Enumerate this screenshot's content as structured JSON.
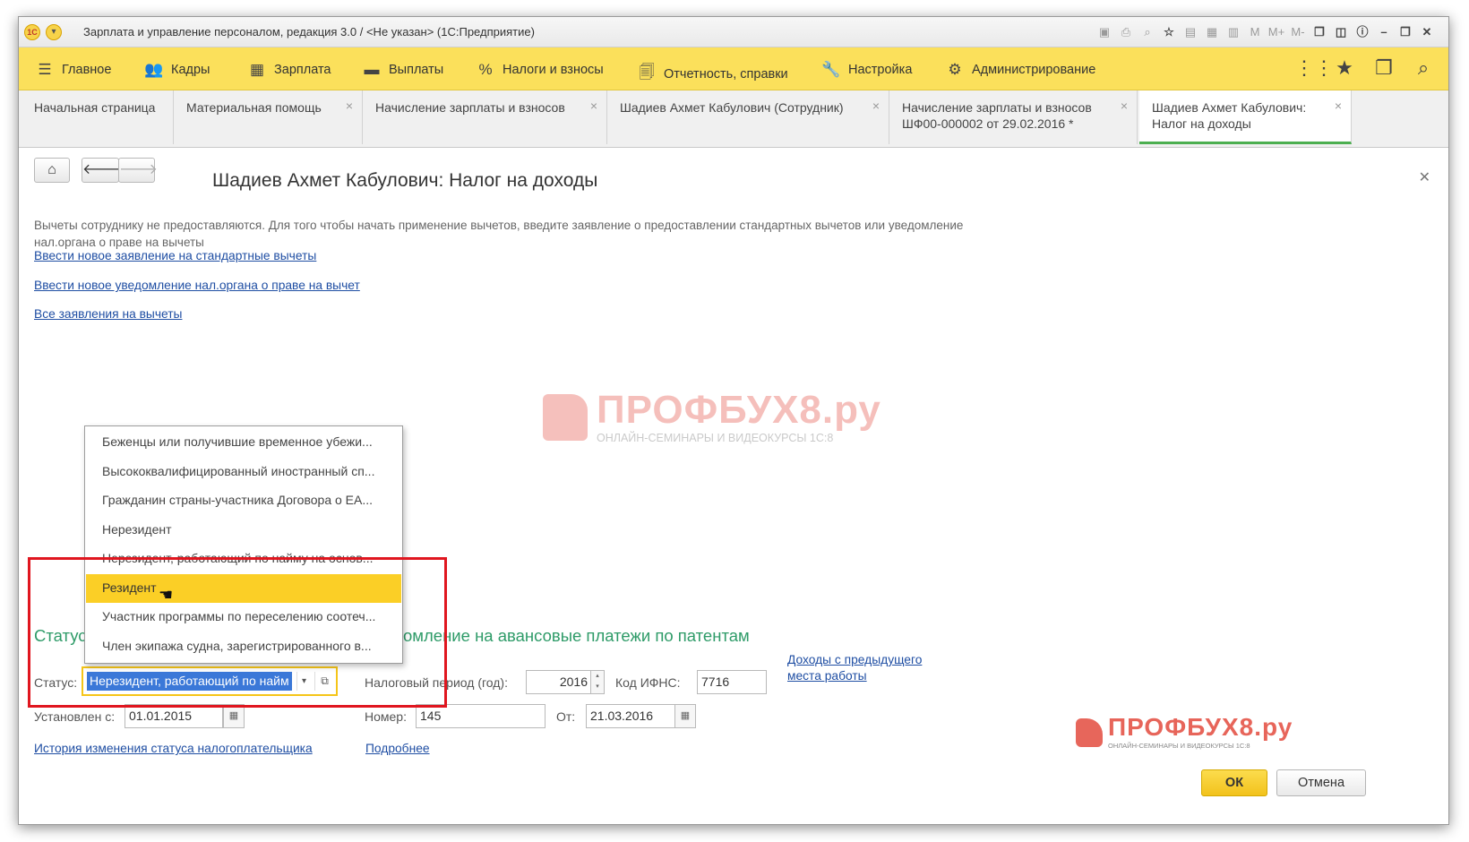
{
  "window": {
    "title": "Зарплата и управление персоналом, редакция 3.0 / <Не указан>  (1С:Предприятие)",
    "title_icons": [
      "save-icon",
      "print-icon",
      "preview-icon",
      "favorites-icon",
      "history-icon",
      "calculator-icon",
      "calendar-icon",
      "M",
      "M+",
      "M-",
      "windows-icon",
      "layout-icon",
      "info-icon",
      "minimize-icon",
      "restore-icon",
      "close-icon"
    ]
  },
  "sections": {
    "items": [
      {
        "label": "Главное",
        "icon": "☰"
      },
      {
        "label": "Кадры",
        "icon": "👥"
      },
      {
        "label": "Зарплата",
        "icon": "▦"
      },
      {
        "label": "Выплаты",
        "icon": "▬"
      },
      {
        "label": "Налоги и взносы",
        "icon": "%"
      },
      {
        "label": "Отчетность, справки",
        "icon": "🗐"
      },
      {
        "label": "Настройка",
        "icon": "🔧"
      },
      {
        "label": "Администрирование",
        "icon": "⚙"
      }
    ]
  },
  "tabs": [
    {
      "label": "Начальная страница"
    },
    {
      "label": "Материальная помощь"
    },
    {
      "label": "Начисление зарплаты и взносов"
    },
    {
      "label": "Шадиев Ахмет Кабулович (Сотрудник)"
    },
    {
      "label": "Начисление зарплаты и взносов ШФ00-000002 от 29.02.2016 *"
    },
    {
      "label": "Шадиев Ахмет Кабулович: Налог на доходы"
    }
  ],
  "form": {
    "title": "Шадиев Ахмет Кабулович: Налог на доходы",
    "info_text": "Вычеты сотруднику не предоставляются. Для того чтобы начать применение вычетов, введите заявление о предоставлении стандартных вычетов или уведомление нал.органа о праве на вычеты",
    "links": {
      "new_application": "Ввести новое заявление на стандартные вычеты",
      "new_notice": "Ввести новое уведомление нал.органа о праве на вычет",
      "all_applications": "Все заявления на вычеты",
      "prev_income": "Доходы с предыдущего места работы",
      "status_history": "История изменения статуса налогоплательщика",
      "more": "Подробнее"
    },
    "status_heading": "Статус",
    "patent_heading": "омление на авансовые платежи по патентам",
    "status_label": "Статус:",
    "status_value": "Нерезидент, работающий по найм",
    "tax_period_label": "Налоговый период (год):",
    "tax_period_value": "2016",
    "ifns_label": "Код ИФНС:",
    "ifns_value": "7716",
    "established_label": "Установлен с:",
    "established_value": "01.01.2015",
    "number_label": "Номер:",
    "number_value": "145",
    "from_label": "От:",
    "from_value": "21.03.2016",
    "ok_label": "ОК",
    "cancel_label": "Отмена"
  },
  "status_options": [
    {
      "label": "Беженцы или получившие временное убежи..."
    },
    {
      "label": "Высококвалифицированный иностранный сп..."
    },
    {
      "label": "Гражданин страны-участника Договора о ЕА..."
    },
    {
      "label": "Нерезидент"
    },
    {
      "label": "Нерезидент, работающий по найму на основ..."
    },
    {
      "label": "Резидент"
    },
    {
      "label": "Участник программы по переселению соотеч..."
    },
    {
      "label": "Член экипажа судна, зарегистрированного в..."
    }
  ],
  "selected_option": "Резидент",
  "watermark": {
    "name": "ПРОФБУХ8.ру",
    "sub": "ОНЛАЙН-СЕМИНАРЫ И ВИДЕОКУРСЫ 1С:8"
  },
  "colors": {
    "accent_yellow": "#fbe05b",
    "selection": "#fbcf26",
    "link": "#1f4ea3",
    "heading_green": "#2e9b68",
    "highlight_red": "#e0161f"
  }
}
